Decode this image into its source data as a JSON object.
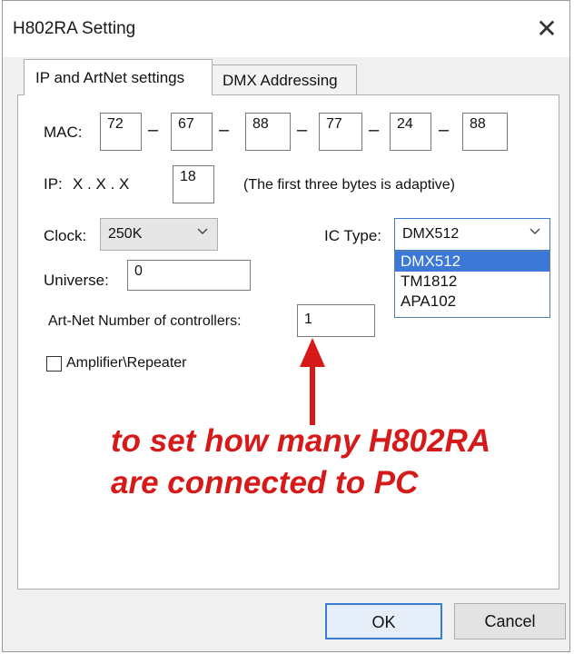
{
  "window": {
    "title": "H802RA Setting",
    "close_glyph": "✕"
  },
  "tabs": [
    {
      "label": "IP and ArtNet settings",
      "active": true
    },
    {
      "label": "DMX Addressing",
      "active": false
    }
  ],
  "mac": {
    "label": "MAC:",
    "octets": [
      "72",
      "67",
      "88",
      "77",
      "24",
      "88"
    ],
    "separator": "–"
  },
  "ip": {
    "label": "IP:",
    "fixed": "X . X . X",
    "value": "18",
    "note": "(The first three bytes  is adaptive)"
  },
  "clock": {
    "label": "Clock:",
    "value": "250K"
  },
  "ic_type": {
    "label": "IC Type:",
    "value": "DMX512",
    "options": [
      "DMX512",
      "TM1812",
      "APA102"
    ],
    "highlighted": "DMX512"
  },
  "universe": {
    "label": "Universe:",
    "value": "0"
  },
  "artnet": {
    "label": "Art-Net Number of controllers:",
    "value": "1"
  },
  "amplifier": {
    "label": "Amplifier\\Repeater",
    "checked": false
  },
  "annotation": {
    "line1": "to set how many H802RA",
    "line2": "are connected to PC",
    "color": "#d61a1a"
  },
  "buttons": {
    "ok": "OK",
    "cancel": "Cancel"
  },
  "colors": {
    "selection": "#3b78d8",
    "focus_border": "#3a7bd5"
  }
}
